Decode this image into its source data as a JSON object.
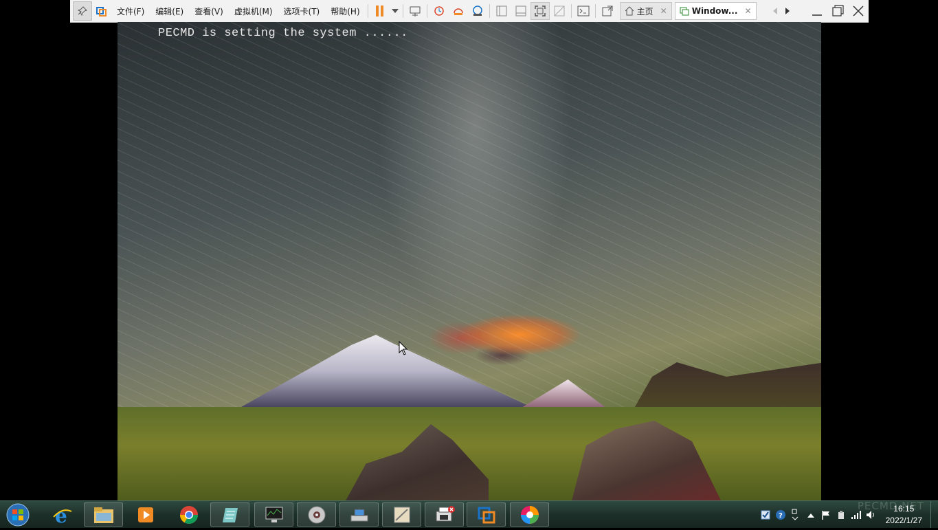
{
  "vmware": {
    "menus": [
      "文件(F)",
      "编辑(E)",
      "查看(V)",
      "虚拟机(M)",
      "选项卡(T)",
      "帮助(H)"
    ],
    "tabs": [
      {
        "label": "主页",
        "icon": "home-icon"
      },
      {
        "label": "Window...",
        "icon": "vm-tab-icon"
      }
    ],
    "accent": "#f08a24"
  },
  "guest": {
    "boot_message": "PECMD is setting the system ......"
  },
  "taskbar": {
    "items": [
      "start-orb",
      "internet-explorer",
      "file-explorer",
      "media-player",
      "chrome",
      "notepad",
      "task-manager",
      "disc-burner",
      "network-tool",
      "image-tool",
      "printer-app",
      "vmware-app",
      "color-wheel-app"
    ],
    "clock_time": "16:15",
    "clock_date": "2022/1/27",
    "watermark": "PECMD.NET"
  }
}
